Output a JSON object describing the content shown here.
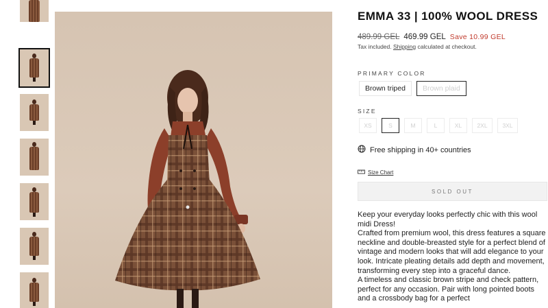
{
  "product": {
    "title": "EMMA 33 | 100% WOOL DRESS",
    "price_old": "489.99 GEL",
    "price_new": "469.99 GEL",
    "price_save": "Save 10.99 GEL",
    "tax_text": "Tax included. ",
    "tax_link": "Shipping",
    "tax_rest": " calculated at checkout."
  },
  "color": {
    "label": "PRIMARY COLOR",
    "options": [
      "Brown triped",
      "Brown plaid"
    ]
  },
  "size": {
    "label": "SIZE",
    "options": [
      "XS",
      "S",
      "M",
      "L",
      "XL",
      "2XL",
      "3XL"
    ]
  },
  "shipping_text": "Free shipping in 40+ countries",
  "size_chart_label": "Size Chart",
  "soldout_label": "SOLD OUT",
  "description": [
    "Keep your everyday looks perfectly chic with this wool midi Dress!",
    "Crafted from premium wool, this dress features a square neckline and double-breasted style for a perfect blend of vintage and modern looks that will add elegance to your look. Intricate pleating details add depth and movement, transforming every step into a graceful dance.",
    "A timeless and classic brown stripe and check pattern, perfect for any occasion. Pair with long pointed boots and a crossbody bag for a perfect"
  ],
  "colors": {
    "accent_red": "#c0392b",
    "dress_brown": "#7a5038",
    "blouse_rust": "#8c3f2a"
  },
  "icons": {
    "shipping": "globe-icon",
    "size_chart": "ruler-icon"
  }
}
